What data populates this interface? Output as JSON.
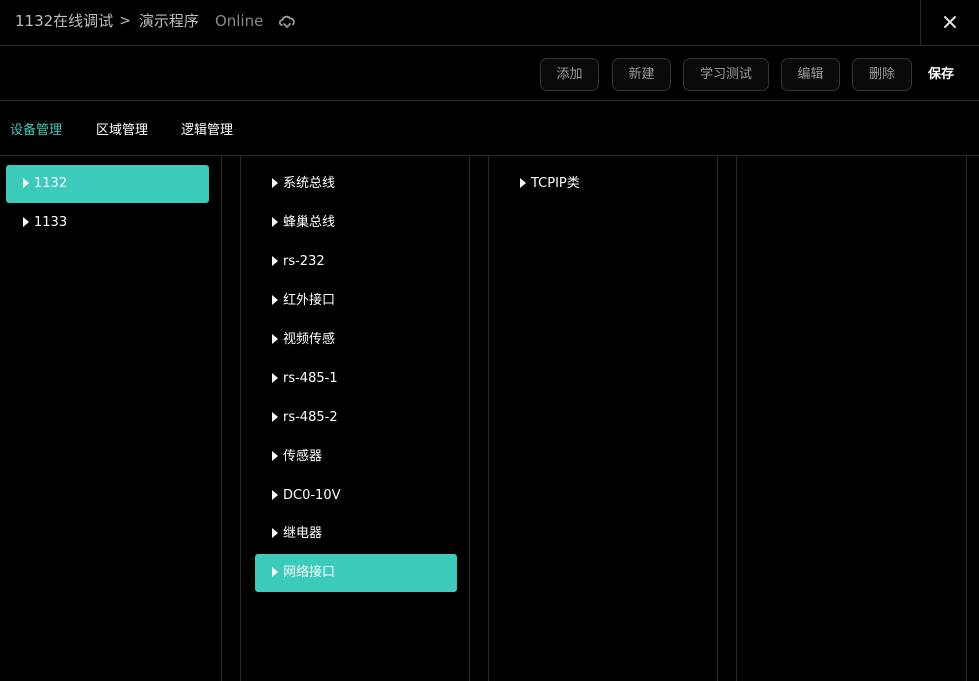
{
  "header": {
    "breadcrumb_root": "1132在线调试",
    "breadcrumb_sep": ">",
    "breadcrumb_current": "演示程序",
    "status": "Online",
    "cloud_icon": "cloud-sync-icon",
    "close_icon": "close-icon"
  },
  "toolbar": {
    "add": "添加",
    "new": "新建",
    "learn_test": "学习测试",
    "edit": "编辑",
    "delete": "删除",
    "save": "保存"
  },
  "tabs": [
    {
      "label": "设备管理",
      "active": true
    },
    {
      "label": "区域管理",
      "active": false
    },
    {
      "label": "逻辑管理",
      "active": false
    }
  ],
  "devices": [
    {
      "label": "1132",
      "selected": true
    },
    {
      "label": "1133",
      "selected": false
    }
  ],
  "interfaces": [
    {
      "label": "系统总线",
      "selected": false
    },
    {
      "label": "蜂巢总线",
      "selected": false
    },
    {
      "label": "rs-232",
      "selected": false
    },
    {
      "label": "红外接口",
      "selected": false
    },
    {
      "label": "视频传感",
      "selected": false
    },
    {
      "label": "rs-485-1",
      "selected": false
    },
    {
      "label": "rs-485-2",
      "selected": false
    },
    {
      "label": "传感器",
      "selected": false
    },
    {
      "label": "DC0-10V",
      "selected": false
    },
    {
      "label": "继电器",
      "selected": false
    },
    {
      "label": "网络接口",
      "selected": true
    }
  ],
  "protocols": [
    {
      "label": "TCPIP类",
      "selected": false
    }
  ],
  "colors": {
    "accent": "#3ccbba",
    "background": "#000000",
    "border": "#2a2a2a"
  }
}
